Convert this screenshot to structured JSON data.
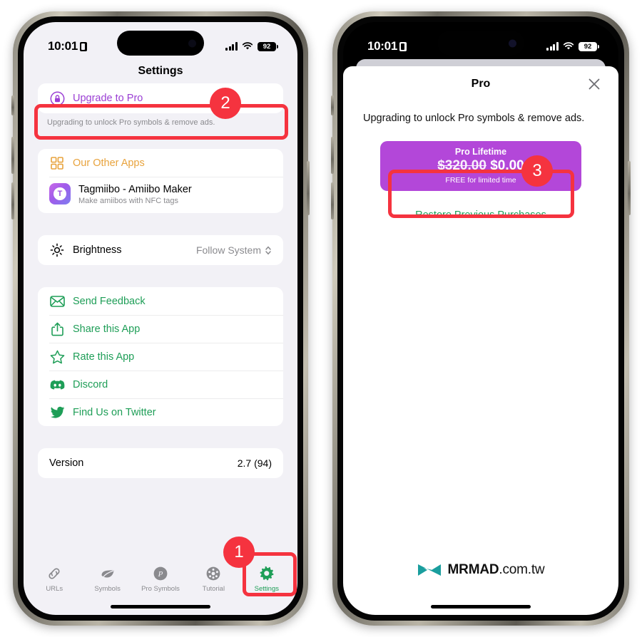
{
  "left_phone": {
    "status_bar": {
      "time": "10:01",
      "location_icon": "location-indicator-icon",
      "signal_icon": "cellular-signal-icon",
      "wifi_icon": "wifi-icon",
      "battery_level": "92"
    },
    "nav_title": "Settings",
    "upgrade": {
      "icon": "lock-circle-icon",
      "label": "Upgrade to Pro",
      "caption": "Upgrading to unlock Pro symbols & remove ads.",
      "accent": "#9b3fd4"
    },
    "other_apps": {
      "header_icon": "grid-apps-icon",
      "header_label": "Our Other Apps",
      "header_accent": "#e8a33d",
      "app": {
        "icon_letter": "T",
        "name": "Tagmiibo - Amiibo Maker",
        "subtitle": "Make amiibos with NFC tags"
      }
    },
    "brightness": {
      "icon": "sun-brightness-icon",
      "label": "Brightness",
      "value": "Follow System",
      "chevron_icon": "chevron-up-down-icon"
    },
    "links": [
      {
        "icon": "envelope-icon",
        "label": "Send Feedback"
      },
      {
        "icon": "share-icon",
        "label": "Share this App"
      },
      {
        "icon": "star-icon",
        "label": "Rate this App"
      },
      {
        "icon": "discord-icon",
        "label": "Discord"
      },
      {
        "icon": "twitter-bird-icon",
        "label": "Find Us on Twitter"
      }
    ],
    "links_accent": "#1e9e57",
    "version": {
      "label": "Version",
      "value": "2.7 (94)"
    },
    "tabs": [
      {
        "icon": "link-chain-icon",
        "label": "URLs",
        "active": false
      },
      {
        "icon": "leaf-icon",
        "label": "Symbols",
        "active": false
      },
      {
        "icon": "pro-circle-p-icon",
        "label": "Pro Symbols",
        "active": false
      },
      {
        "icon": "tutorial-dots-circle-icon",
        "label": "Tutorial",
        "active": false
      },
      {
        "icon": "gear-icon",
        "label": "Settings",
        "active": true
      }
    ]
  },
  "right_phone": {
    "status_bar": {
      "time": "10:01",
      "location_icon": "location-indicator-icon",
      "signal_icon": "cellular-signal-icon",
      "wifi_icon": "wifi-icon",
      "battery_level": "92"
    },
    "sheet": {
      "title": "Pro",
      "close_icon": "close-icon",
      "description": "Upgrading to unlock Pro symbols & remove ads.",
      "purchase": {
        "title": "Pro Lifetime",
        "old_price": "$320.00",
        "new_price": "$0.00",
        "note": "FREE for limited time",
        "color": "#b347d9"
      },
      "restore_label": "Restore Previous Purchases",
      "restore_accent": "#1e9e57"
    },
    "watermark": {
      "logo_icon": "mrmad-bowtie-logo-icon",
      "brand": "MRMAD",
      "domain": ".com.tw",
      "logo_color": "#1a9e9e"
    }
  },
  "annotations": {
    "badge_1": "1",
    "badge_2": "2",
    "badge_3": "3",
    "color": "#f5333f"
  }
}
